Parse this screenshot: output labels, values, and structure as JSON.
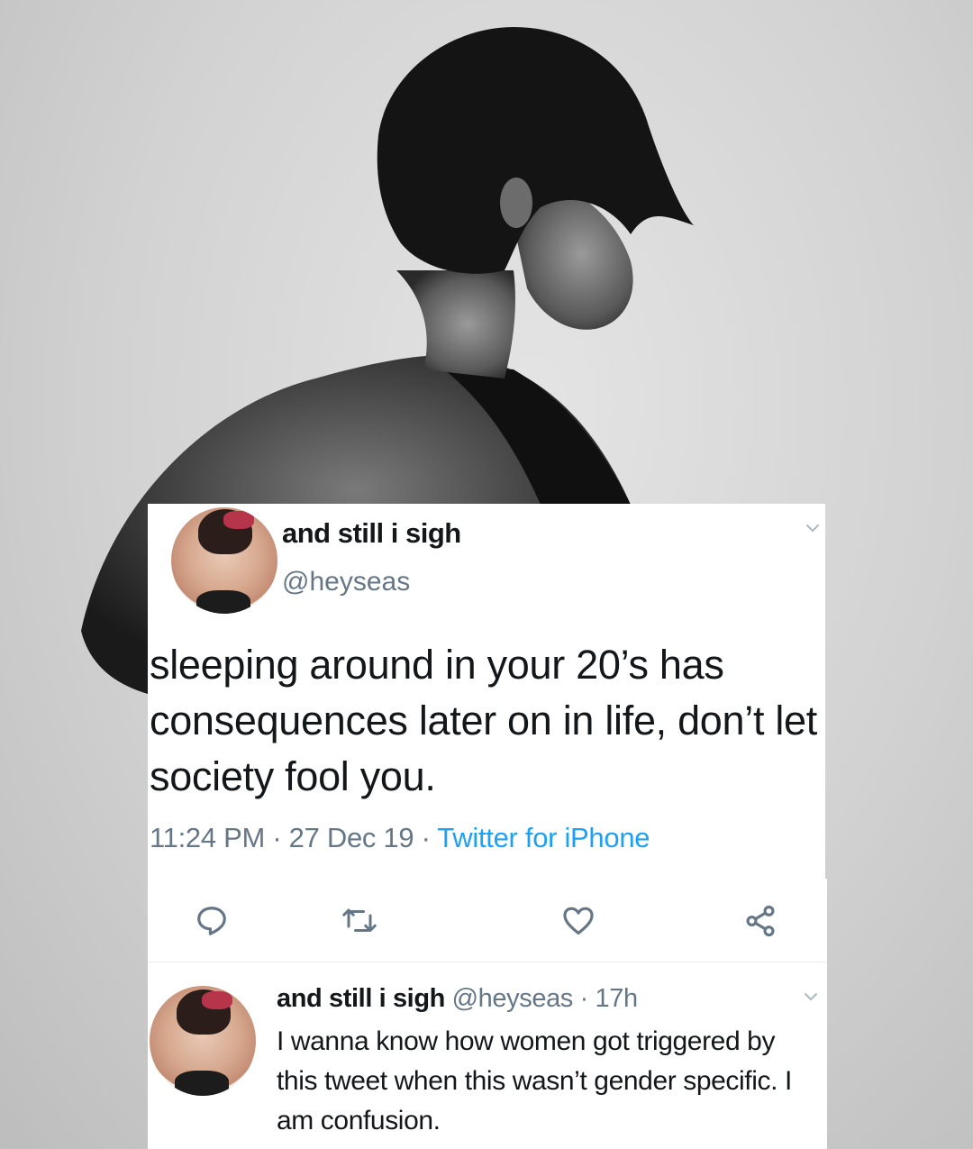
{
  "tweet": {
    "display_name": "and still i sigh",
    "handle": "@heyseas",
    "text": "sleeping around in your 20’s has consequences later on in life, don’t let society fool you.",
    "time": "11:24 PM",
    "date": "27 Dec 19",
    "source": "Twitter for iPhone",
    "separator": " · ",
    "actions": {
      "reply_icon": "reply-bubble-icon",
      "retweet_icon": "retweet-icon",
      "like_icon": "heart-icon",
      "share_icon": "share-icon"
    }
  },
  "reply": {
    "display_name": "and still i sigh",
    "handle": "@heyseas",
    "time": "17h",
    "separator": " · ",
    "text": "I wanna know how women got triggered by this tweet when this wasn’t gender specific. I am confusion."
  },
  "colors": {
    "text_primary": "#14171a",
    "text_secondary": "#657786",
    "link_blue": "#1da1f2",
    "card_background": "#ffffff"
  }
}
